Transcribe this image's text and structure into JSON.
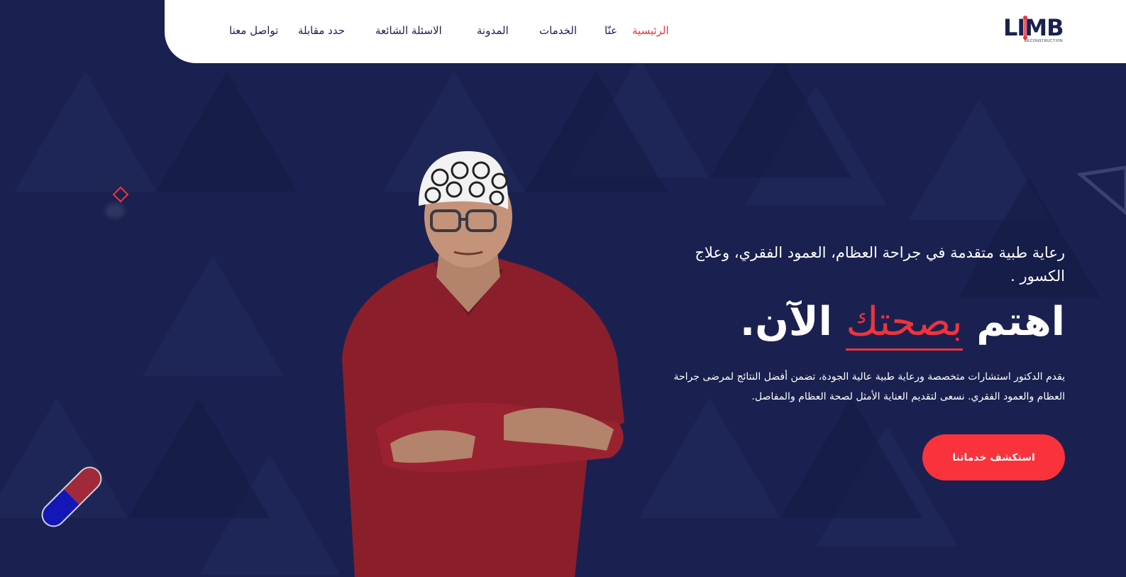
{
  "colors": {
    "background": "#1a2150",
    "accent": "#f0333d",
    "nav_text": "#1a2150",
    "white": "#ffffff"
  },
  "logo": {
    "text": "LIMB",
    "subtext": "RECONSTRUCTION"
  },
  "nav": {
    "items": [
      {
        "label": "الرئيسية",
        "active": true
      },
      {
        "label": "عنّا"
      },
      {
        "label": "الخدمات"
      },
      {
        "label": "المدونة"
      },
      {
        "label": "الاسئلة الشائعة"
      },
      {
        "label": "حدد مقابلة"
      },
      {
        "label": "تواصل معنا"
      }
    ]
  },
  "hero": {
    "tagline": "رعاية طبية متقدمة في جراحة العظام، العمود الفقري، وعلاج الكسور .",
    "headline_start": "اهتم ",
    "headline_accent": "بصحتك",
    "headline_end": " الآن.",
    "description": "يقدم الدكتور استشارات متخصصة ورعاية طبية عالية الجودة، تضمن أفضل النتائج لمرضى جراحة العظام والعمود الفقري. نسعى لتقديم العناية الأمثل لصحة العظام والمفاصل.",
    "cta_label": "استكشف خدماتنا"
  },
  "icons": {
    "logo": "limb-logo-icon",
    "decor_diamond": "diamond-outline-icon",
    "decor_pill": "capsule-icon",
    "decor_triangle": "triangle-outline-icon"
  }
}
